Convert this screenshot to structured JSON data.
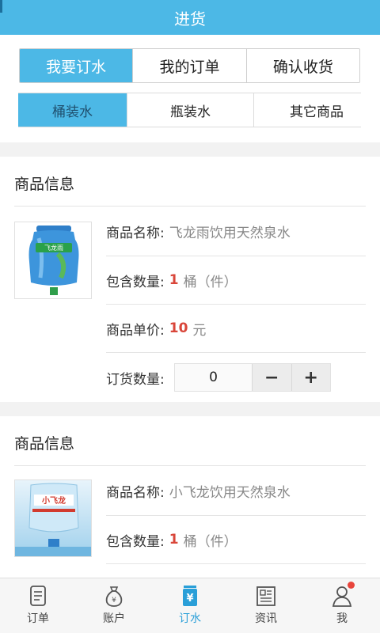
{
  "header": {
    "title": "进货"
  },
  "main_tabs": [
    {
      "label": "我要订水",
      "active": true
    },
    {
      "label": "我的订单",
      "active": false
    },
    {
      "label": "确认收货",
      "active": false
    }
  ],
  "sub_tabs": [
    {
      "label": "桶装水",
      "active": true
    },
    {
      "label": "瓶装水",
      "active": false
    },
    {
      "label": "其它商品",
      "active": false
    }
  ],
  "products": [
    {
      "section_title": "商品信息",
      "name_label": "商品名称:",
      "name": "飞龙雨饮用天然泉水",
      "image_brand_text": "飞龙雨",
      "count_label": "包含数量:",
      "count": "1",
      "count_unit": "桶（件）",
      "price_label": "商品单价:",
      "price": "10",
      "price_unit": "元",
      "qty_label": "订货数量:",
      "qty_value": "0",
      "minus": "−",
      "plus": "+"
    },
    {
      "section_title": "商品信息",
      "name_label": "商品名称:",
      "name": "小飞龙饮用天然泉水",
      "image_brand_text": "小飞龙",
      "count_label": "包含数量:",
      "count": "1",
      "count_unit": "桶（件）"
    }
  ],
  "tabbar": [
    {
      "label": "订单",
      "icon": "order-icon",
      "active": false
    },
    {
      "label": "账户",
      "icon": "money-bag-icon",
      "active": false
    },
    {
      "label": "订水",
      "icon": "yen-cup-icon",
      "active": true
    },
    {
      "label": "资讯",
      "icon": "news-icon",
      "active": false
    },
    {
      "label": "我",
      "icon": "user-icon",
      "active": false,
      "badge": true
    }
  ],
  "colors": {
    "accent": "#4cb8e6",
    "highlight": "#d9463a",
    "active_tab": "#2a9fd8"
  }
}
